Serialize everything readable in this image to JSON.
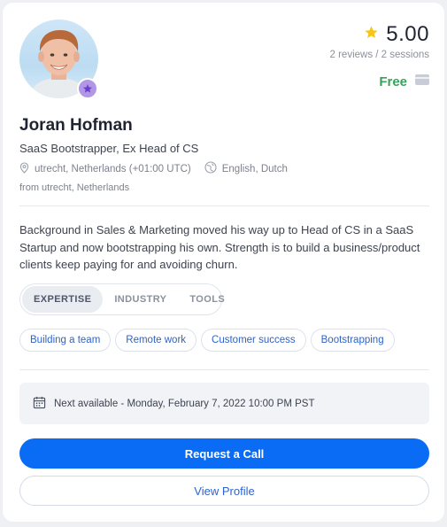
{
  "profile": {
    "name": "Joran Hofman",
    "headline": "SaaS Bootstrapper, Ex Head of CS",
    "location": "utrecht, Netherlands (+01:00 UTC)",
    "languages": "English, Dutch",
    "from": "from utrecht, Netherlands",
    "bio": "Background in Sales & Marketing moved his way up to Head of CS in a SaaS Startup and now bootstrapping his own. Strength is to build a business/product clients keep paying for and avoiding churn."
  },
  "rating": {
    "value": "5.00",
    "meta": "2 reviews / 2 sessions"
  },
  "price": {
    "label": "Free"
  },
  "tabs": [
    {
      "label": "EXPERTISE",
      "active": true
    },
    {
      "label": "INDUSTRY",
      "active": false
    },
    {
      "label": "TOOLS",
      "active": false
    }
  ],
  "tags": [
    "Building a team",
    "Remote work",
    "Customer success",
    "Bootstrapping"
  ],
  "availability": {
    "text": "Next available - Monday, February 7, 2022 10:00 PM PST"
  },
  "actions": {
    "request_label": "Request a Call",
    "view_label": "View Profile"
  },
  "colors": {
    "primary": "#0a6cf5",
    "price_green": "#3aa05c",
    "star": "#f5c518",
    "badge_purple": "#b197e6",
    "link_blue": "#2e63c9"
  },
  "icons": [
    "star-icon",
    "card-icon",
    "location-pin-icon",
    "globe-icon",
    "calendar-icon",
    "badge-star-icon"
  ]
}
